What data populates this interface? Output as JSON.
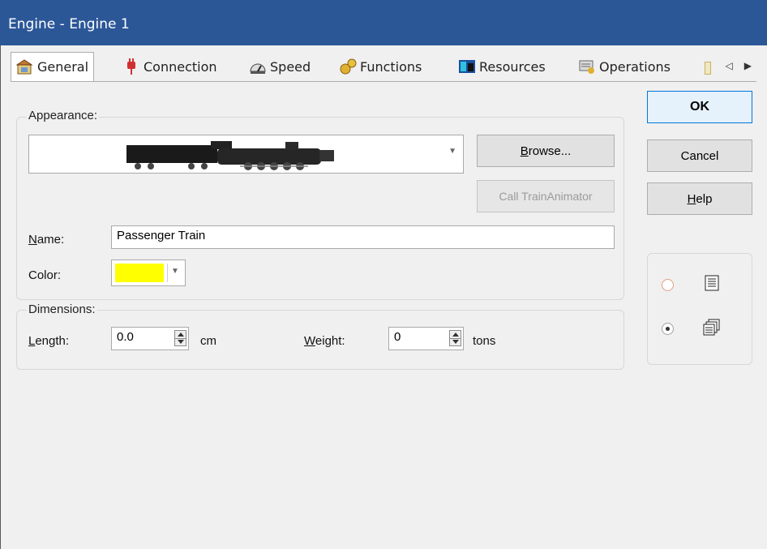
{
  "window": {
    "title": "Engine - Engine 1"
  },
  "tabs": [
    {
      "label": "General",
      "icon": "general-properties-icon"
    },
    {
      "label": "Connection",
      "icon": "plug-icon"
    },
    {
      "label": "Speed",
      "icon": "speedometer-icon"
    },
    {
      "label": "Functions",
      "icon": "functions-icon"
    },
    {
      "label": "Resources",
      "icon": "resources-icon"
    },
    {
      "label": "Operations",
      "icon": "operations-icon"
    }
  ],
  "appearance": {
    "group_label": "Appearance:",
    "browse_label": "Browse...",
    "call_label": "Call TrainAnimator"
  },
  "name": {
    "label": "Name:",
    "value": "Passenger Train"
  },
  "color": {
    "label": "Color:",
    "value": "#ffff00"
  },
  "dimensions": {
    "group_label": "Dimensions:",
    "length_label": "Length:",
    "length_value": "0.0",
    "length_unit": "cm",
    "weight_label": "Weight:",
    "weight_value": "0",
    "weight_unit": "tons"
  },
  "buttons": {
    "ok": "OK",
    "cancel": "Cancel",
    "help": "Help"
  },
  "view_options": [
    {
      "icon": "list-view-icon",
      "selected": false
    },
    {
      "icon": "multi-page-view-icon",
      "selected": true
    }
  ]
}
